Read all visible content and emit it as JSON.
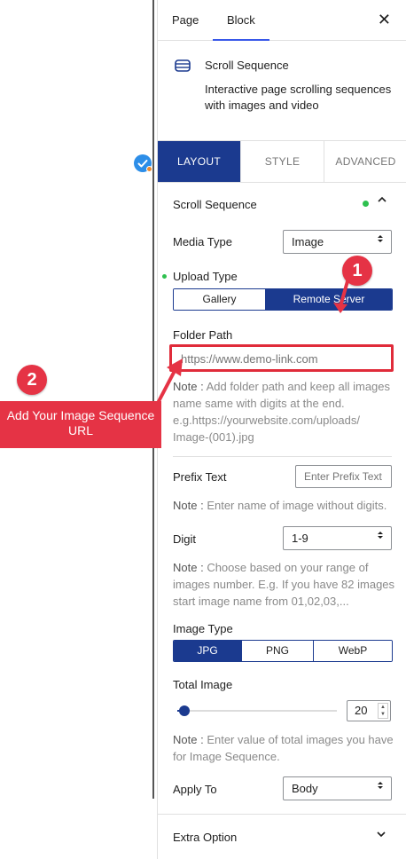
{
  "sidebar_tabs": {
    "page": "Page",
    "block": "Block",
    "close": "✕"
  },
  "block": {
    "title": "Scroll Sequence",
    "description": "Interactive page scrolling sequences with images and video"
  },
  "settings_tabs": [
    "LAYOUT",
    "STYLE",
    "ADVANCED"
  ],
  "section": {
    "title": "Scroll Sequence"
  },
  "media_type": {
    "label": "Media Type",
    "value": "Image"
  },
  "upload_type": {
    "label": "Upload Type",
    "options": [
      "Gallery",
      "Remote Server"
    ],
    "active": "Remote Server"
  },
  "folder_path": {
    "label": "Folder Path",
    "placeholder": "https://www.demo-link.com",
    "note_prefix": "Note :",
    "note": "Add folder path and keep all images name same with digits at the end. e.g.https://yourwebsite.com/uploads/ Image-(001).jpg"
  },
  "prefix_text": {
    "label": "Prefix Text",
    "placeholder": "Enter Prefix Text",
    "note_prefix": "Note :",
    "note": "Enter name of image without digits."
  },
  "digit": {
    "label": "Digit",
    "value": "1-9",
    "note_prefix": "Note :",
    "note": "Choose based on your range of images number. E.g. If you have 82 images start image name from 01,02,03,..."
  },
  "image_type": {
    "label": "Image Type",
    "options": [
      "JPG",
      "PNG",
      "WebP"
    ],
    "active": "JPG"
  },
  "total_image": {
    "label": "Total Image",
    "value": "20",
    "note_prefix": "Note :",
    "note": "Enter value of total images you have for Image Sequence."
  },
  "apply_to": {
    "label": "Apply To",
    "value": "Body"
  },
  "extra_option": {
    "label": "Extra Option"
  },
  "annotations": {
    "badge_1": "1",
    "badge_2": "2",
    "callout": "Add Your Image Sequence URL"
  },
  "colors": {
    "accent": "#1b3a8f",
    "annotation": "#e53345",
    "status_dot": "#2ec04f"
  }
}
